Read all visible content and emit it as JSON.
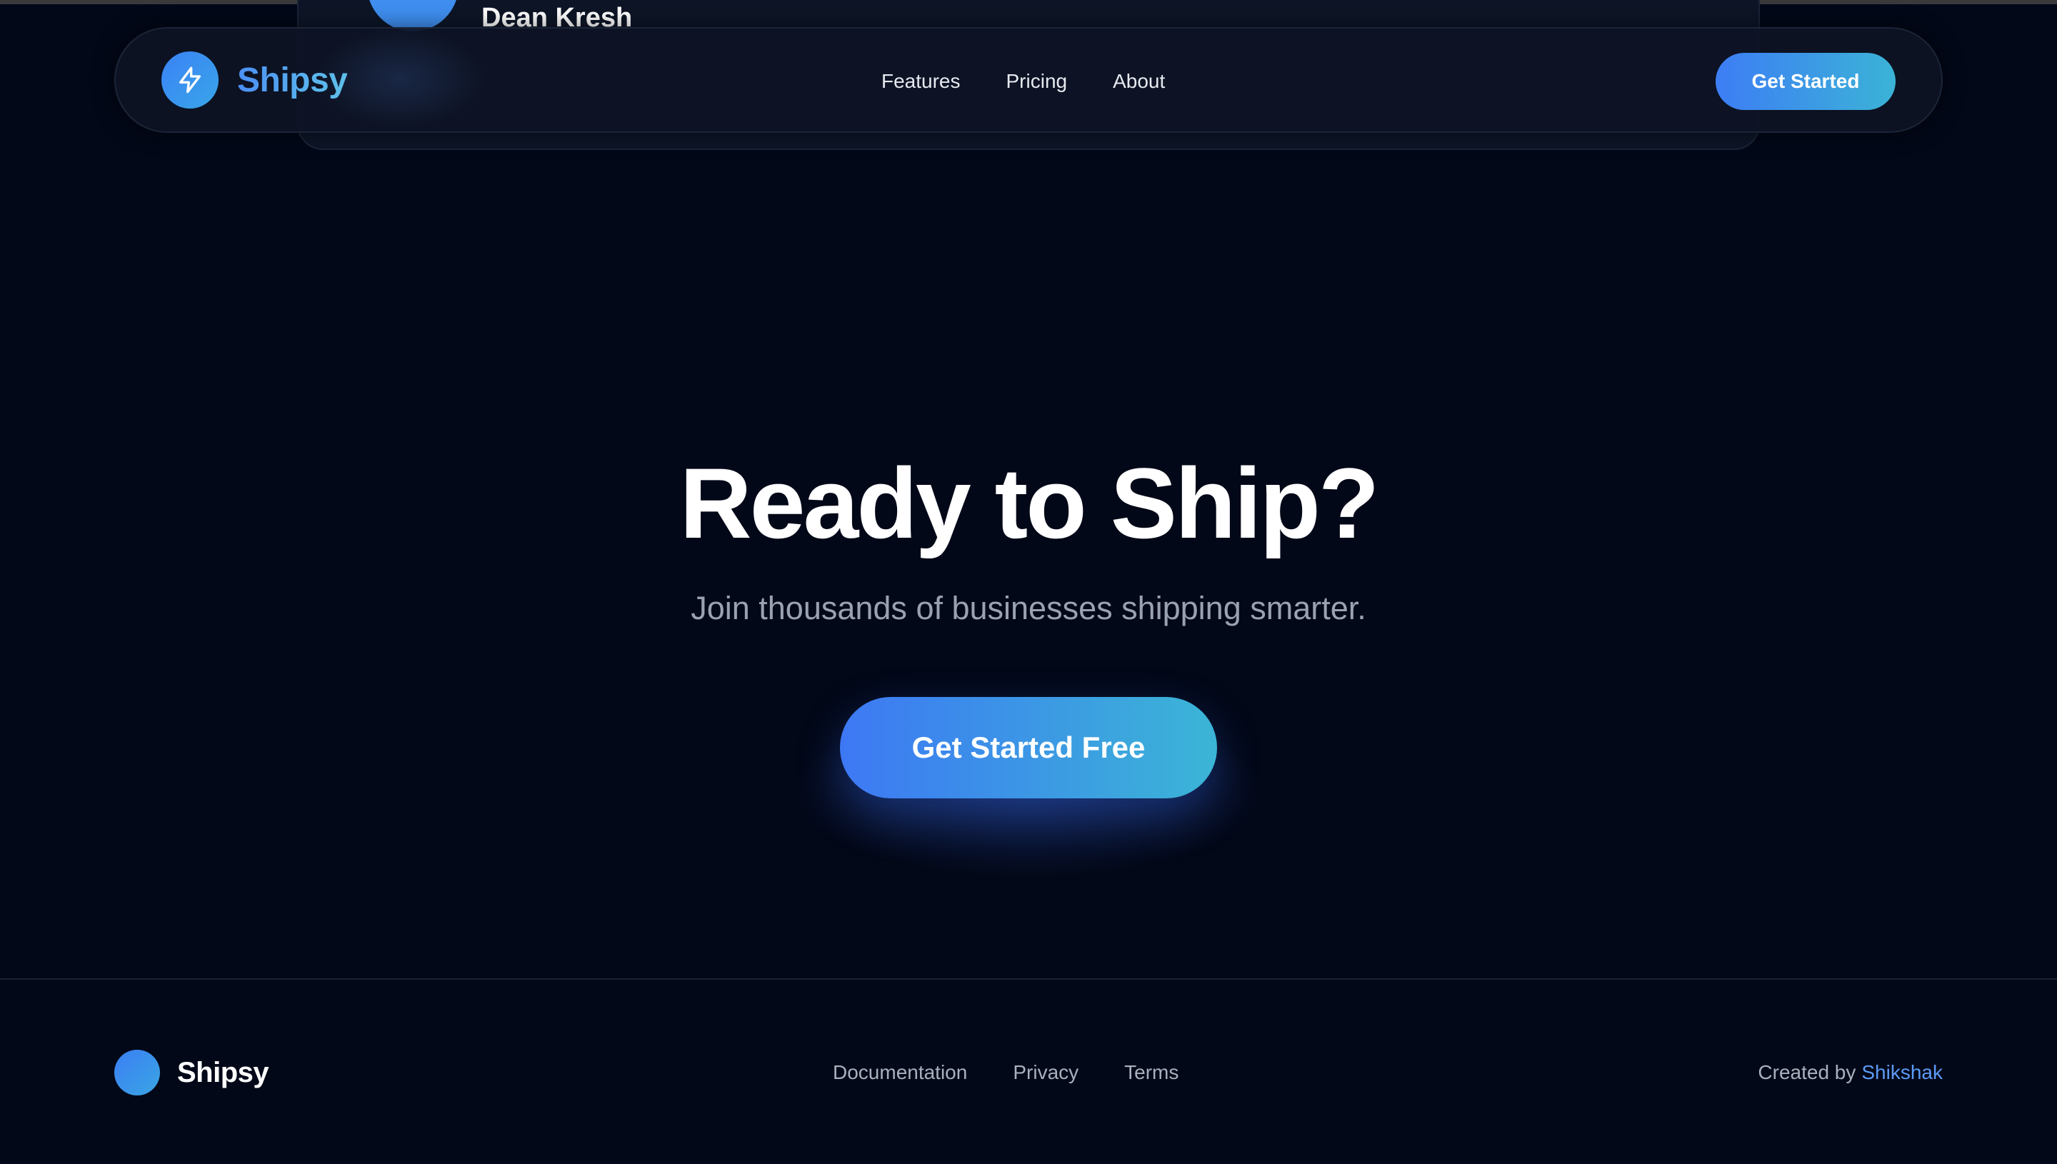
{
  "peek_card": {
    "name": "Dean Kresh"
  },
  "nav": {
    "brand": "Shipsy",
    "links": [
      "Features",
      "Pricing",
      "About"
    ],
    "cta": "Get Started"
  },
  "hero": {
    "title": "Ready to Ship?",
    "subtitle": "Join thousands of businesses shipping smarter.",
    "cta": "Get Started Free"
  },
  "footer": {
    "brand": "Shipsy",
    "links": [
      "Documentation",
      "Privacy",
      "Terms"
    ],
    "credit_prefix": "Created by",
    "credit_name": "Shikshak"
  },
  "colors": {
    "background": "#030818",
    "accent_start": "#3d7df5",
    "accent_end": "#3bb3d6",
    "credit_link": "#5c9bf6"
  },
  "icons": {
    "brand": "lightning-bolt-icon"
  }
}
